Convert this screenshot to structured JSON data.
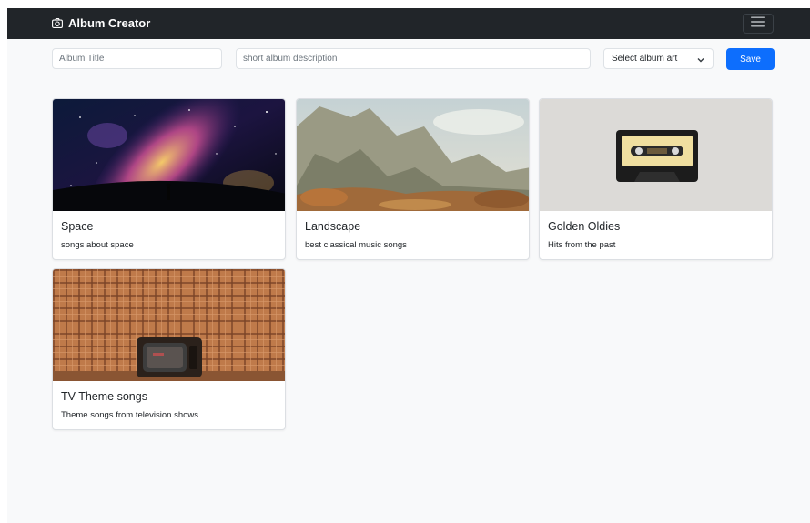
{
  "navbar": {
    "brand": "Album Creator",
    "brand_icon": "camera-icon",
    "menu_icon": "hamburger-icon"
  },
  "form": {
    "title_placeholder": "Album Title",
    "description_placeholder": "short album description",
    "select_value": "Select album art",
    "save_label": "Save"
  },
  "colors": {
    "navbar": "#212529",
    "primary": "#0d6efd",
    "page_bg": "#f8f9fa"
  },
  "albums": [
    {
      "title": "Space",
      "description": "songs about space",
      "art": "night-sky-milky-way"
    },
    {
      "title": "Landscape",
      "description": "best classical music songs",
      "art": "mountain-landscape-painting"
    },
    {
      "title": "Golden Oldies",
      "description": "Hits from the past",
      "art": "cassette-tape"
    },
    {
      "title": "TV Theme songs",
      "description": "Theme songs from television shows",
      "art": "retro-television"
    }
  ]
}
